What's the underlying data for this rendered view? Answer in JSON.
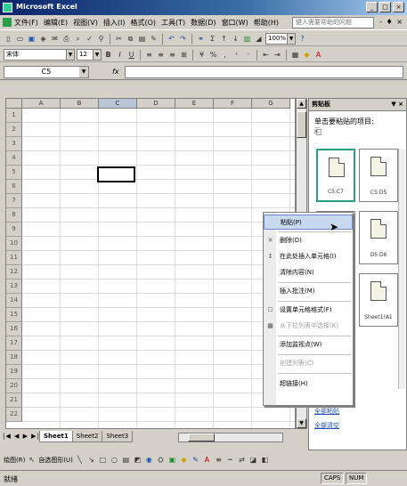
{
  "window": {
    "title": "Microsoft Excel",
    "buttons": [
      "_",
      "□",
      "×"
    ]
  },
  "menubar": {
    "items": [
      "文件(F)",
      "编辑(E)",
      "视图(V)",
      "插入(I)",
      "格式(O)",
      "工具(T)",
      "数据(D)",
      "窗口(W)",
      "帮助(H)"
    ],
    "help_placeholder": "键入需要帮助的问题",
    "close_doc": "- ♦ ×"
  },
  "toolbar": {
    "zoom": "100%",
    "font_name": "宋体",
    "font_size": "12"
  },
  "formula_bar": {
    "name_box": "C5",
    "fx": "fx",
    "content": ""
  },
  "sheet": {
    "columns": [
      "A",
      "B",
      "C",
      "D",
      "E",
      "F",
      "G"
    ],
    "rows": [
      "1",
      "2",
      "3",
      "4",
      "5",
      "6",
      "7",
      "8",
      "9",
      "10",
      "11",
      "12",
      "13",
      "14",
      "15",
      "16",
      "17",
      "18",
      "19",
      "20",
      "21",
      "22"
    ],
    "active_cell": "C5",
    "tabs": [
      "Sheet1",
      "Sheet2",
      "Sheet3"
    ],
    "tab_nav": "|◀ ◀ ▶ ▶|"
  },
  "drawing_toolbar": {
    "draw_label": "绘图(R)",
    "autoshapes_label": "自选图形(U)"
  },
  "statusbar": {
    "ready": "就绪",
    "caps": "CAPS",
    "num": "NUM"
  },
  "task_pane": {
    "title": "剪贴板",
    "label": "单击要粘贴的项目:",
    "clips": [
      {
        "caption": "C5:C7",
        "selected": true
      },
      {
        "caption": "C5:D5"
      },
      {
        "caption": "",
        "selected": false
      },
      {
        "caption": "D5:D6"
      },
      {
        "caption": "",
        "selected": false
      },
      {
        "caption": "Sheet1!A1"
      }
    ],
    "link_paste_all": "全部粘贴",
    "link_clear_all": "全部清空"
  },
  "context_menu": {
    "items": [
      {
        "label": "粘贴(P)",
        "hot": true,
        "disabled": false,
        "icon": ""
      },
      {
        "label": "删除(D)",
        "hot": false,
        "disabled": false,
        "icon": "✕"
      },
      {
        "label": "在此处插入单元格(I)",
        "hot": false,
        "disabled": false,
        "icon": "↕"
      },
      {
        "label": "清除内容(N)",
        "hot": false,
        "disabled": false,
        "icon": ""
      },
      {
        "label": "插入批注(M)",
        "hot": false,
        "disabled": false,
        "icon": ""
      },
      {
        "label": "设置单元格格式(F)",
        "hot": false,
        "disabled": false,
        "icon": "☐"
      },
      {
        "label": "从下拉列表中选择(K)",
        "hot": false,
        "disabled": true,
        "icon": "▦"
      },
      {
        "label": "添加监视点(W)",
        "hot": false,
        "disabled": false,
        "icon": ""
      },
      {
        "label": "创建列表(C)",
        "hot": false,
        "disabled": true,
        "icon": ""
      },
      {
        "label": "超链接(H)",
        "hot": false,
        "disabled": false,
        "icon": ""
      }
    ]
  }
}
